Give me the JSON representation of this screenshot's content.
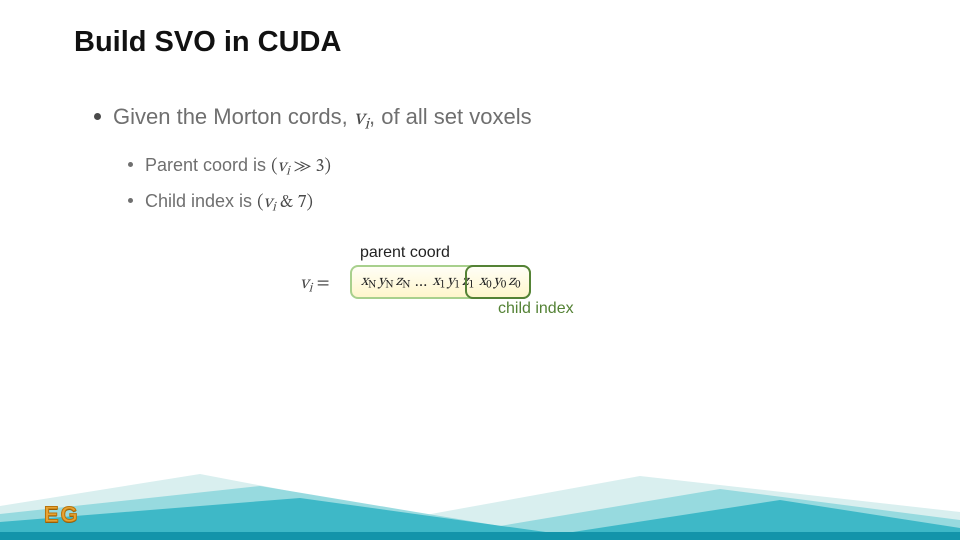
{
  "title": "Build SVO in CUDA",
  "bullet1_prefix": "Given the Morton cords, ",
  "bullet1_var": "v",
  "bullet1_var_sub": "i",
  "bullet1_suffix": ", of all set voxels",
  "sub_b1_prefix": "Parent coord is ",
  "sub_b1_expr_open": "(",
  "sub_b1_expr_var": "v",
  "sub_b1_expr_sub": "i",
  "sub_b1_expr_op": " ≫ 3",
  "sub_b1_expr_close": ")",
  "sub_b2_prefix": "Child index is ",
  "sub_b2_expr_open": "(",
  "sub_b2_expr_var": "v",
  "sub_b2_expr_sub": "i",
  "sub_b2_expr_op": " & 7",
  "sub_b2_expr_close": ")",
  "diagram": {
    "parent_label": "parent coord",
    "child_label": "child index",
    "vi_var": "v",
    "vi_sub": "i",
    "vi_eq": " = ",
    "bits_leading": [
      {
        "x": "x",
        "s": "N"
      },
      {
        "x": "y",
        "s": "N"
      },
      {
        "x": "z",
        "s": "N"
      }
    ],
    "ellipsis": "…",
    "bits_mid": [
      {
        "x": "x",
        "s": "1"
      },
      {
        "x": "y",
        "s": "1"
      },
      {
        "x": "z",
        "s": "1"
      }
    ],
    "bits_last": [
      {
        "x": "x",
        "s": "0"
      },
      {
        "x": "y",
        "s": "0"
      },
      {
        "x": "z",
        "s": "0"
      }
    ]
  },
  "logo": "EG"
}
